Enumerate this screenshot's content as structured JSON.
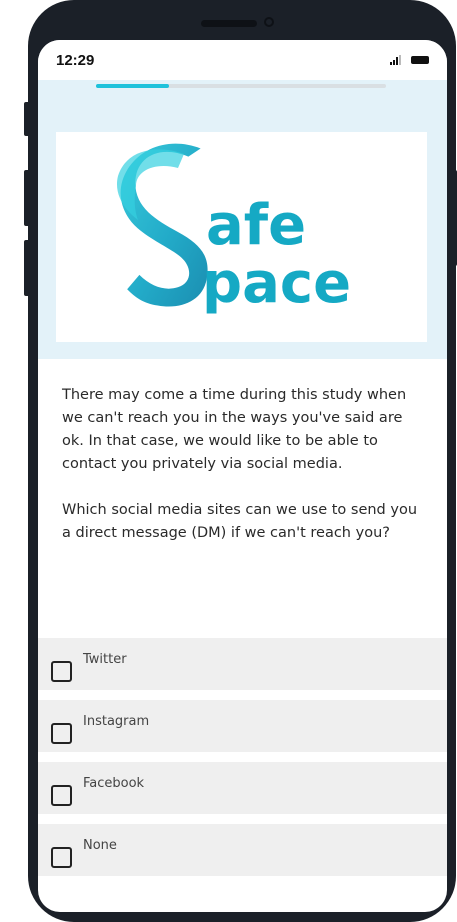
{
  "status_bar": {
    "time": "12:29"
  },
  "survey": {
    "progress_fraction": 0.25,
    "logo_text": {
      "line1": "afe",
      "line2": "pace"
    },
    "intro_paragraph": "There may come a time during this study when we can't reach you in the ways you've said are ok. In that case, we would like to be able to contact you privately via social media.",
    "question": "Which social media sites can we use to send you a direct message (DM) if we can't reach you?",
    "options": [
      {
        "label": "Twitter",
        "checked": false
      },
      {
        "label": "Instagram",
        "checked": false
      },
      {
        "label": "Facebook",
        "checked": false
      },
      {
        "label": "None",
        "checked": false
      }
    ]
  },
  "colors": {
    "accent": "#1ec2db",
    "logo_teal": "#15a9c4",
    "hero_background": "#e3f2f9",
    "option_background": "#efefef"
  }
}
